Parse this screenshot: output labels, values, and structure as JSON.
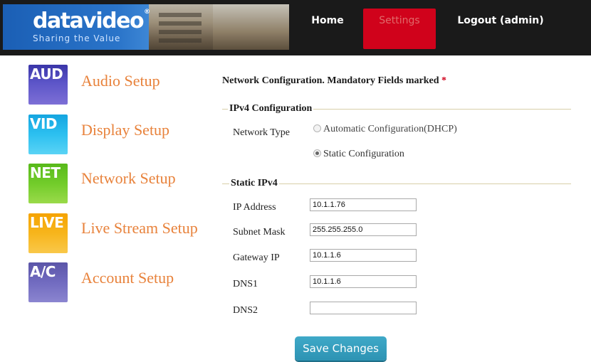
{
  "header": {
    "logo_text": "datavideo",
    "logo_reg": "®",
    "logo_tagline": "Sharing the Value",
    "nav": {
      "home": "Home",
      "settings": "Settings",
      "logout": "Logout (admin)"
    },
    "colors": {
      "bar": "#1a1a1a",
      "active": "#d0021b"
    }
  },
  "sidebar": {
    "items": [
      {
        "icon_text": "AUD",
        "label": "Audio Setup"
      },
      {
        "icon_text": "VID",
        "label": "Display Setup"
      },
      {
        "icon_text": "NET",
        "label": "Network Setup"
      },
      {
        "icon_text": "LIVE",
        "label": "Live Stream Setup"
      },
      {
        "icon_text": "A/C",
        "label": "Account Setup"
      }
    ],
    "label_color": "#e8823b"
  },
  "form": {
    "mandatory_text": "Network Configuration. Mandatory Fields marked",
    "mandatory_star": "*",
    "ipv4": {
      "legend": "IPv4 Configuration",
      "network_type_label": "Network Type",
      "options": [
        {
          "label": "Automatic Configuration(DHCP)",
          "selected": false
        },
        {
          "label": "Static Configuration",
          "selected": true
        }
      ]
    },
    "static": {
      "legend": "Static IPv4",
      "fields": [
        {
          "label": "IP Address",
          "value": "10.1.1.76"
        },
        {
          "label": "Subnet Mask",
          "value": "255.255.255.0"
        },
        {
          "label": "Gateway IP",
          "value": "10.1.1.6"
        },
        {
          "label": "DNS1",
          "value": "10.1.1.6"
        },
        {
          "label": "DNS2",
          "value": ""
        }
      ]
    },
    "save_label": "Save Changes"
  }
}
